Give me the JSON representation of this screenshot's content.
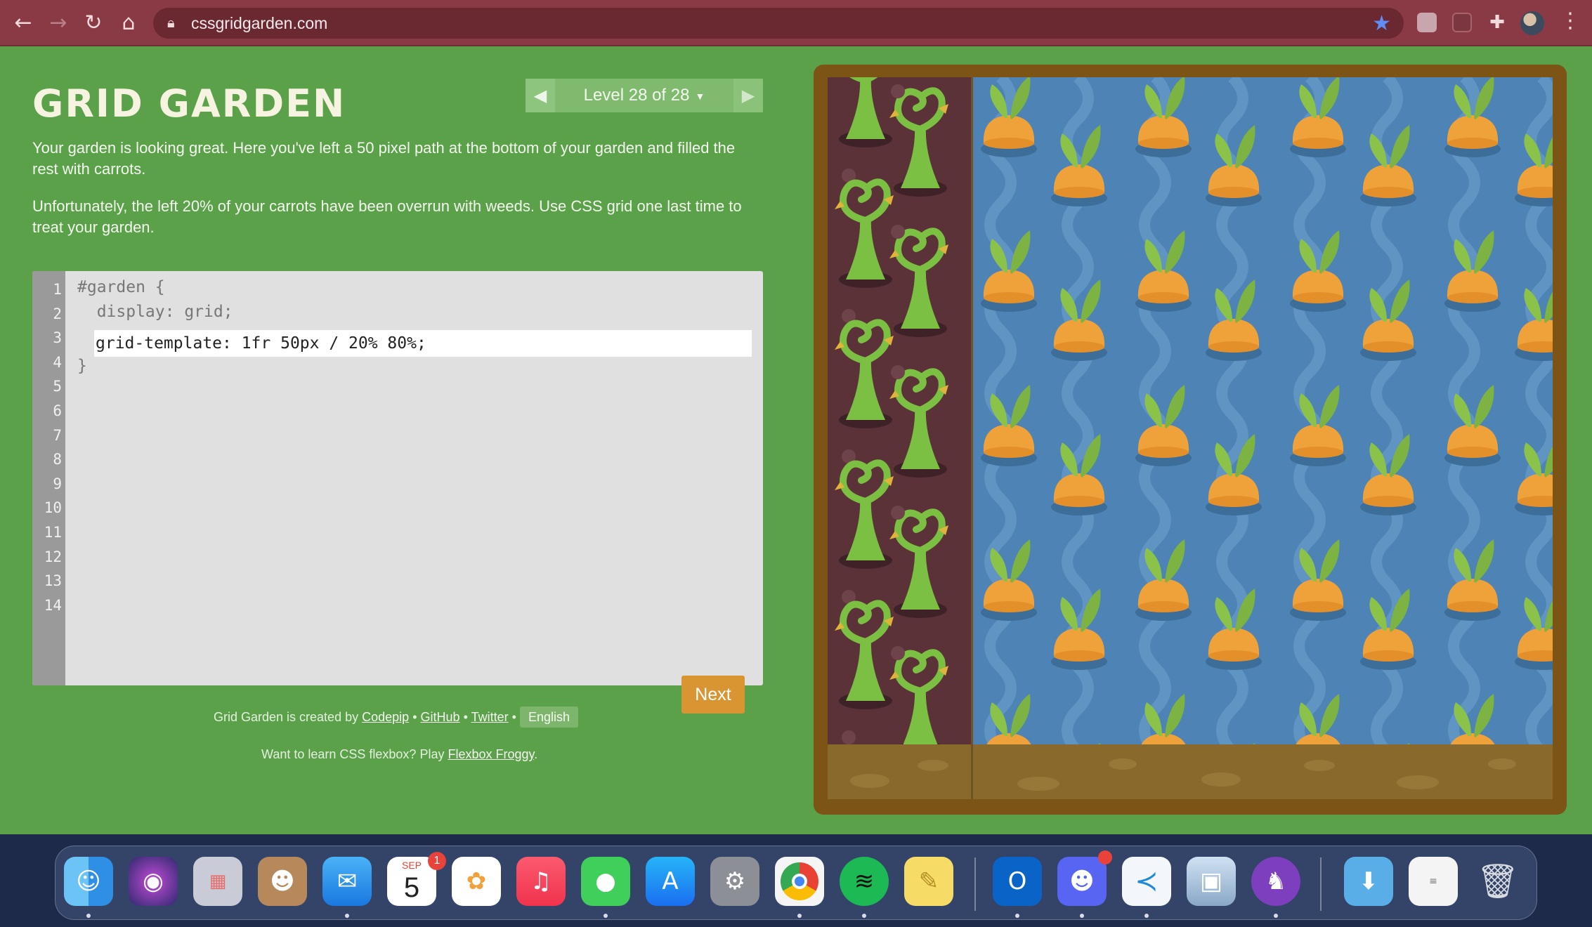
{
  "browser": {
    "url": "cssgridgarden.com"
  },
  "page": {
    "title": "GRID GARDEN",
    "level_label": "Level 28 of 28",
    "instructions": [
      "Your garden is looking great. Here you've left a 50 pixel path at the bottom of your garden and filled the rest with carrots.",
      "Unfortunately, the left 20% of your carrots have been overrun with weeds. Use CSS grid one last time to treat your garden."
    ],
    "editor": {
      "line_numbers": [
        "1",
        "2",
        "3",
        "4",
        "5",
        "6",
        "7",
        "8",
        "9",
        "10",
        "11",
        "12",
        "13",
        "14"
      ],
      "line1": "#garden {",
      "line2": "  display: grid;",
      "input_value": "grid-template: 1fr 50px / 20% 80%;",
      "line4": "}",
      "next_label": "Next"
    },
    "credits": {
      "prefix": "Grid Garden is created by",
      "codepip": "Codepip",
      "sep": "•",
      "github": "GitHub",
      "twitter": "Twitter",
      "language": "English"
    },
    "flexbox": {
      "prefix": "Want to learn CSS flexbox? Play",
      "link": "Flexbox Froggy",
      "suffix": "."
    }
  },
  "dock": {
    "calendar_month": "SEP",
    "calendar_day": "5",
    "calendar_badge": "1",
    "apps": [
      "finder",
      "siri",
      "launchpad",
      "contacts",
      "mail",
      "calendar",
      "photos",
      "music",
      "messages",
      "app-store",
      "system-preferences",
      "chrome",
      "spotify",
      "stickies",
      "outlook",
      "discord",
      "vscode",
      "preview",
      "github-desktop",
      "downloads",
      "document",
      "trash"
    ]
  }
}
